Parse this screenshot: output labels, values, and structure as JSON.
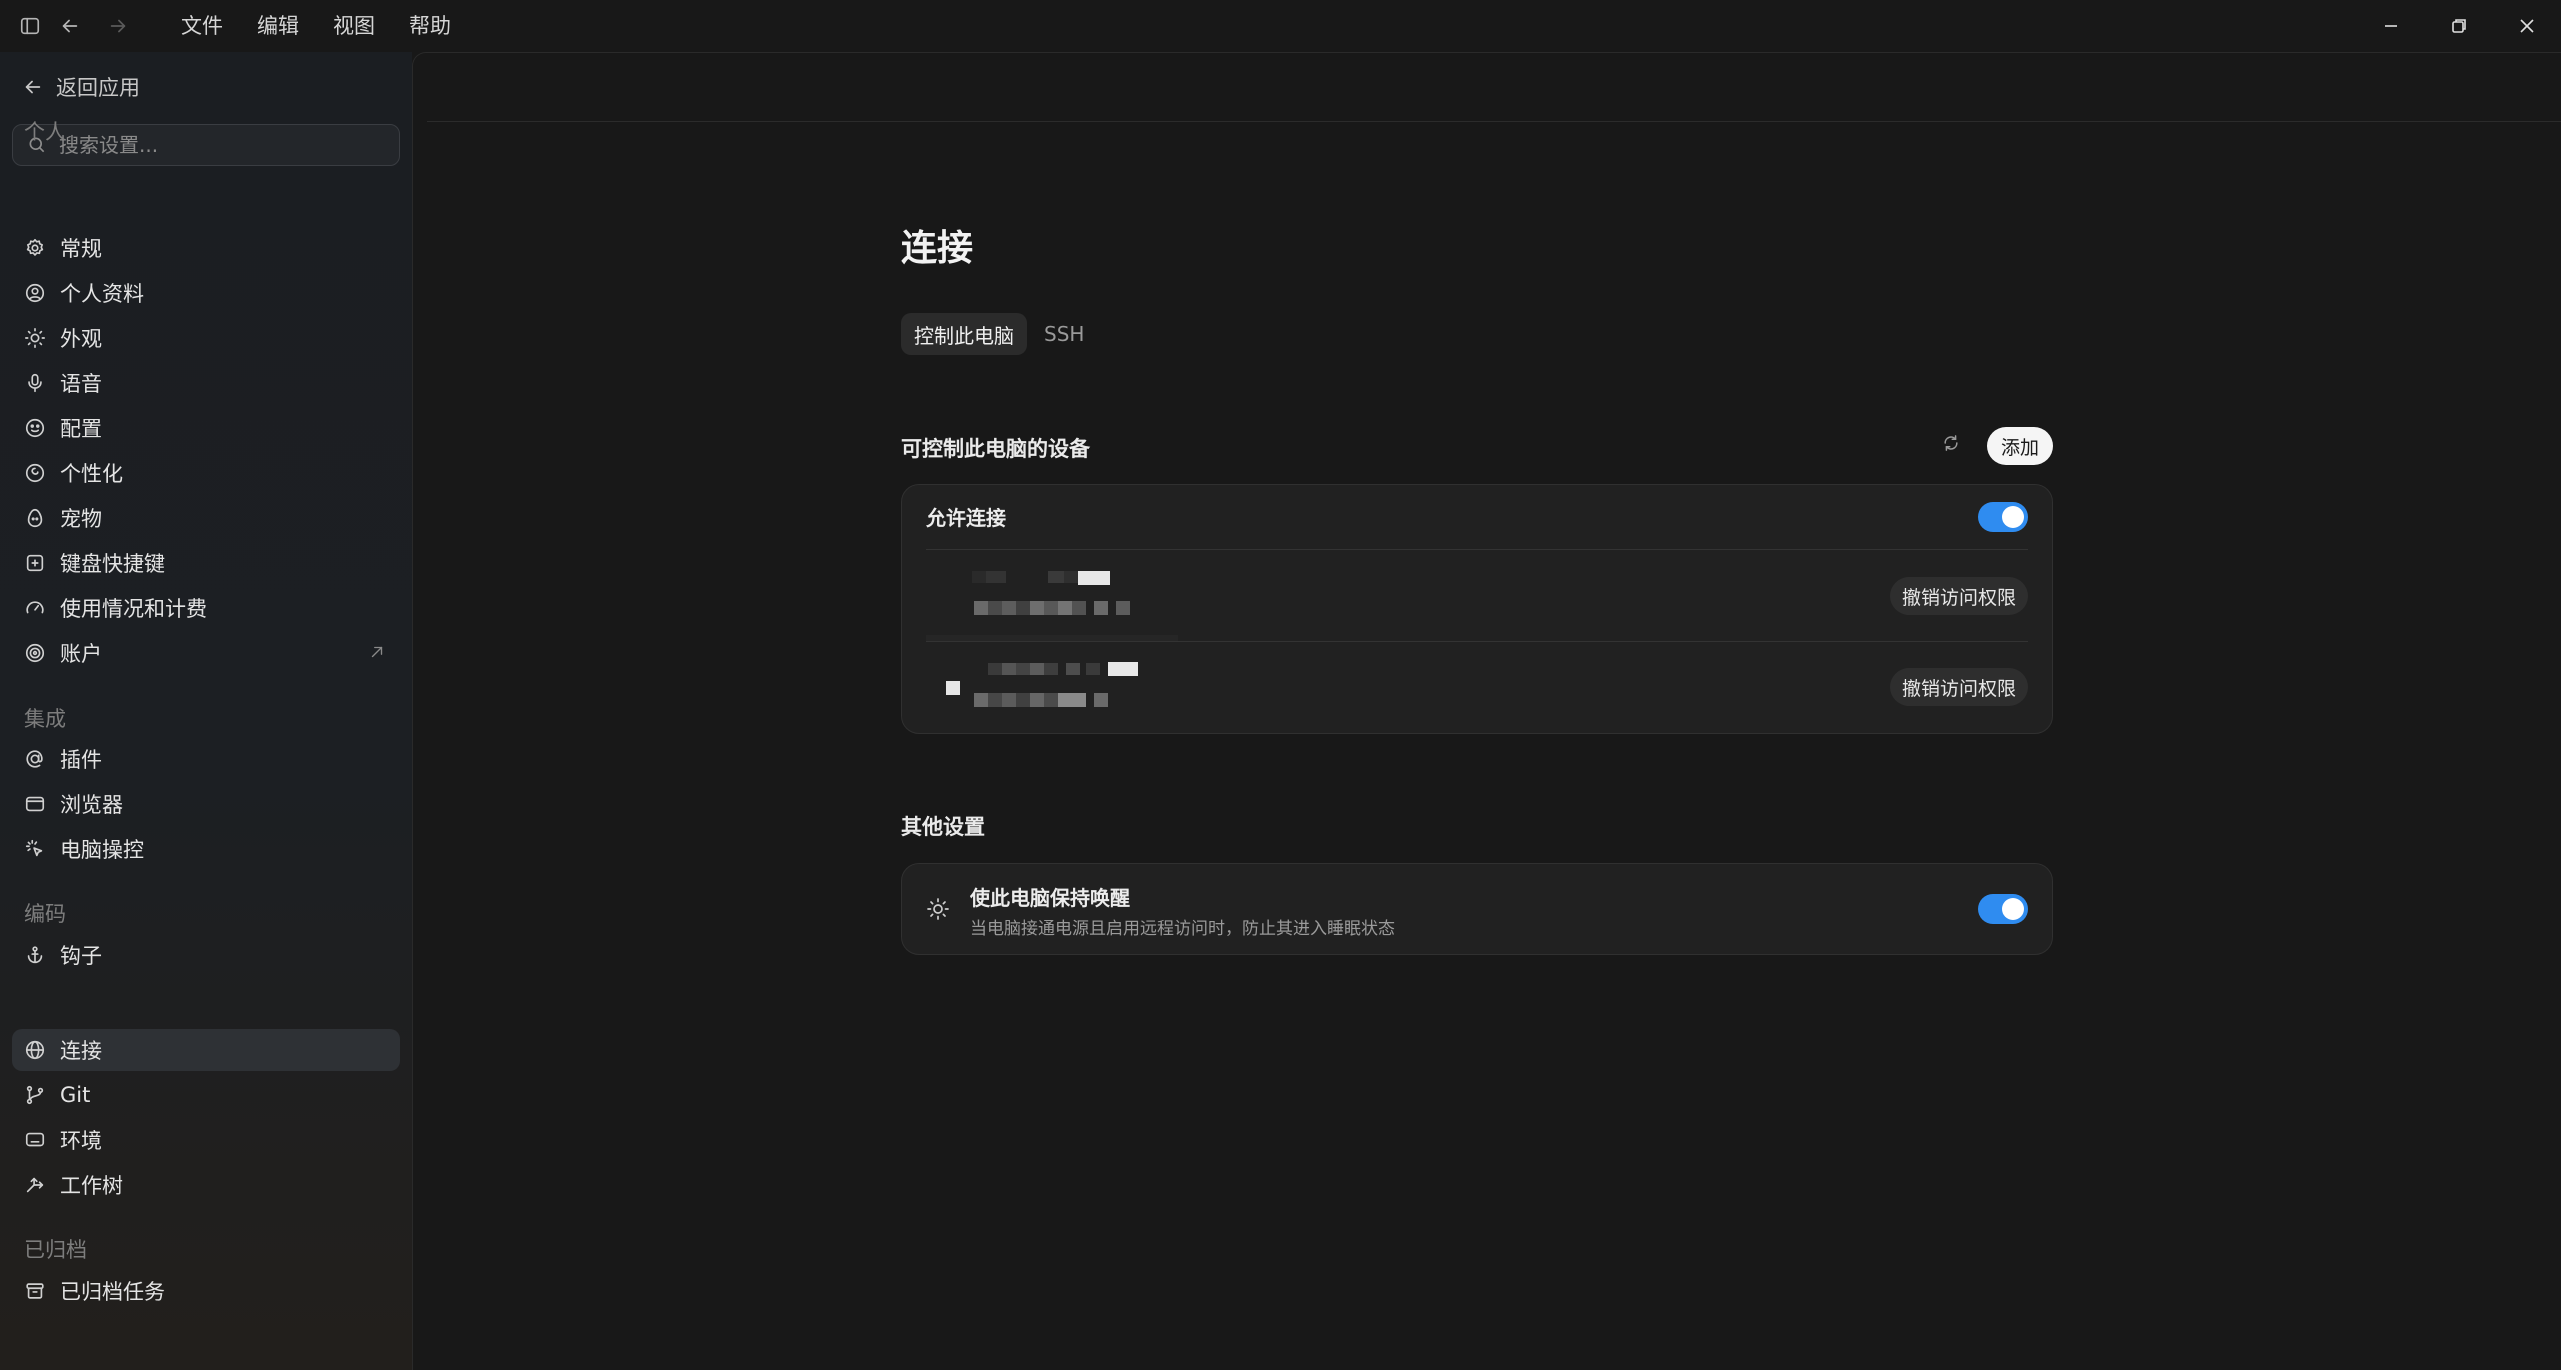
{
  "titlebar": {
    "menu": [
      "文件",
      "编辑",
      "视图",
      "帮助"
    ]
  },
  "sidebar": {
    "back_label": "返回应用",
    "search_placeholder": "搜索设置...",
    "sections": [
      {
        "label": "个人",
        "items": [
          {
            "label": "常规",
            "icon": "gear-icon"
          },
          {
            "label": "个人资料",
            "icon": "user-circle-icon"
          },
          {
            "label": "外观",
            "icon": "sun-icon"
          },
          {
            "label": "语音",
            "icon": "microphone-icon"
          },
          {
            "label": "配置",
            "icon": "face-icon"
          },
          {
            "label": "个性化",
            "icon": "swirl-icon"
          },
          {
            "label": "宠物",
            "icon": "egg-icon"
          },
          {
            "label": "键盘快捷键",
            "icon": "keyboard-icon"
          },
          {
            "label": "使用情况和计费",
            "icon": "gauge-icon"
          },
          {
            "label": "账户",
            "icon": "account-icon"
          }
        ]
      },
      {
        "label": "集成",
        "items": [
          {
            "label": "插件",
            "icon": "at-icon"
          },
          {
            "label": "浏览器",
            "icon": "browser-icon"
          },
          {
            "label": "电脑操控",
            "icon": "cursor-click-icon"
          }
        ]
      },
      {
        "label": "编码",
        "items": [
          {
            "label": "钩子",
            "icon": "anchor-icon"
          },
          {
            "label": "连接",
            "icon": "globe-icon",
            "active": true
          },
          {
            "label": "Git",
            "icon": "git-branch-icon"
          },
          {
            "label": "环境",
            "icon": "monitor-icon"
          },
          {
            "label": "工作树",
            "icon": "worktree-icon"
          }
        ]
      },
      {
        "label": "已归档",
        "items": [
          {
            "label": "已归档任务",
            "icon": "archive-icon"
          }
        ]
      }
    ]
  },
  "main": {
    "title": "连接",
    "tabs": [
      {
        "label": "控制此电脑",
        "active": true
      },
      {
        "label": "SSH",
        "active": false
      }
    ],
    "devices_section": {
      "title": "可控制此电脑的设备",
      "add_label": "添加",
      "allow_label": "允许连接",
      "allow_enabled": true,
      "revoke_label": "撤销访问权限"
    },
    "other_section": {
      "title": "其他设置",
      "keep_awake_title": "使此电脑保持唤醒",
      "keep_awake_desc": "当电脑接通电源且启用远程访问时，防止其进入睡眠状态",
      "keep_awake_enabled": true
    }
  },
  "colors": {
    "accent": "#2f8cf0",
    "background": "#181818",
    "card": "#212121"
  }
}
